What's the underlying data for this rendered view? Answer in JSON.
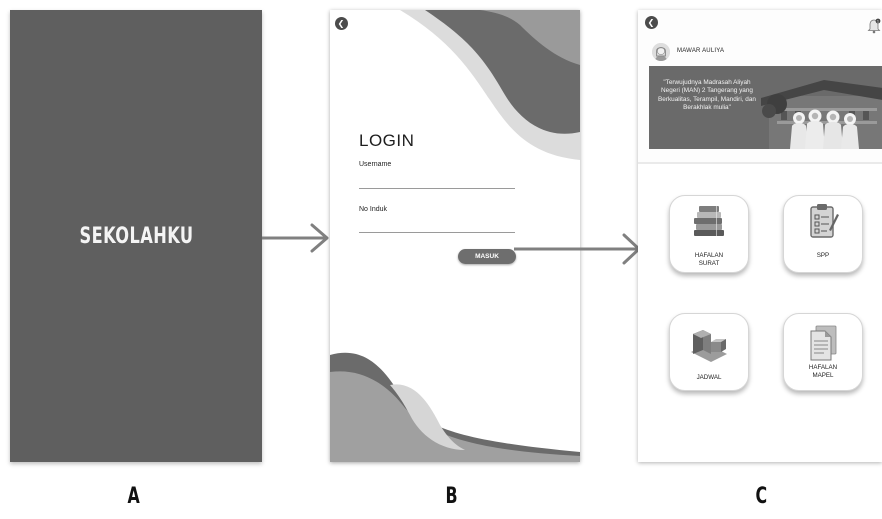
{
  "screen_a": {
    "title": "SEKOLAHKU",
    "background": "#5f5f5f"
  },
  "screen_b": {
    "back_icon": "chevron-left-icon",
    "title": "LOGIN",
    "username_label": "Username",
    "username_value": "",
    "no_induk_label": "No Induk",
    "no_induk_value": "",
    "submit_label": "MASUK"
  },
  "screen_c": {
    "back_icon": "chevron-left-icon",
    "notification_icon": "bell-icon",
    "user_name": "MAWAR AULIYA",
    "banner_text": "\"Terwujudnya Madrasah Aliyah Negeri (MAN) 2 Tangerang yang Berkualitas, Terampil, Mandiri, dan Berakhlak mulia\"",
    "menu": [
      {
        "label": "HAFALAN SURAT",
        "icon": "book-stack-icon"
      },
      {
        "label": "SPP",
        "icon": "clipboard-checklist-icon"
      },
      {
        "label": "JADWAL",
        "icon": "schedule-boxes-icon"
      },
      {
        "label": "HAFALAN MAPEL",
        "icon": "document-pages-icon"
      }
    ]
  },
  "captions": [
    "A",
    "B",
    "C"
  ],
  "colors": {
    "dark_gray": "#5f5f5f",
    "wave_dark": "#6b6b6b",
    "wave_mid": "#a0a0a0",
    "wave_light": "#dcdcdc",
    "arrow": "#808080"
  }
}
